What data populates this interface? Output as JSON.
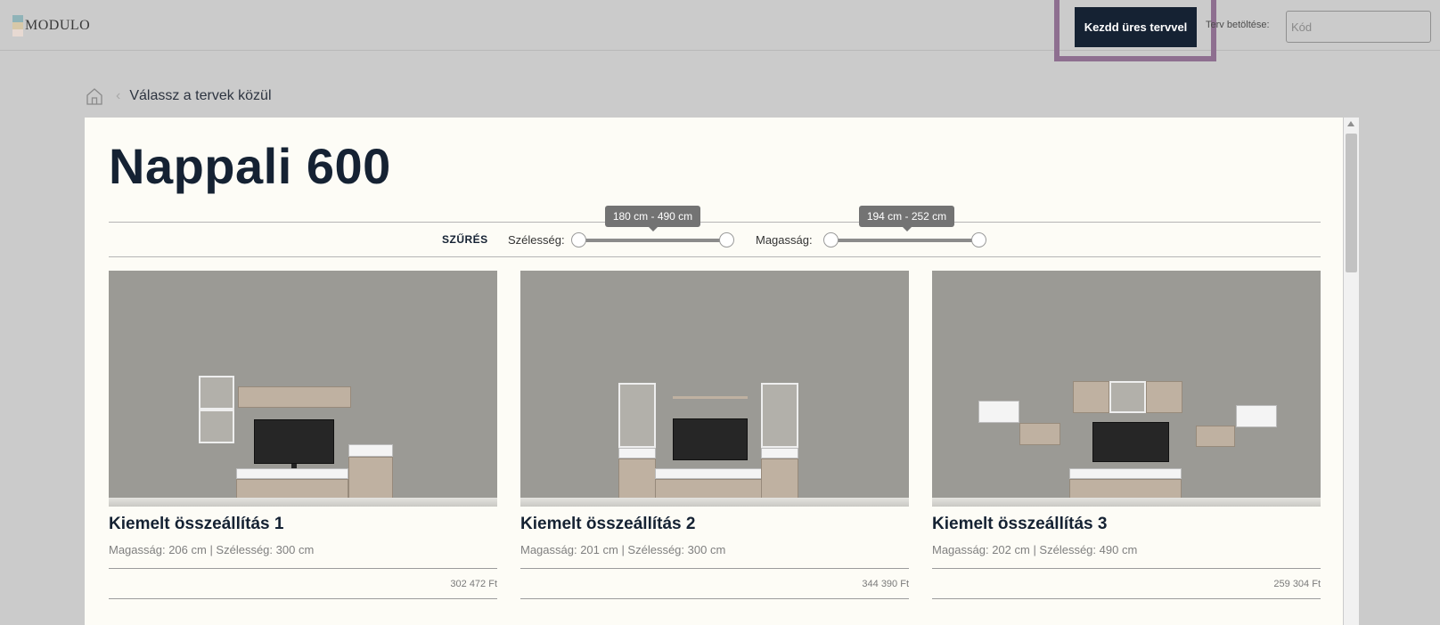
{
  "header": {
    "logo_text": "MODULO",
    "start_button": "Kezdd üres tervvel",
    "load_label": "Terv betöltése:",
    "code_placeholder": "Kód"
  },
  "breadcrumb": {
    "home_icon": "home-icon",
    "separator_icon": "chevron-left-icon",
    "current": "Válassz a tervek közül"
  },
  "page": {
    "title": "Nappali 600"
  },
  "filter": {
    "label": "SZŰRÉS",
    "width": {
      "label": "Szélesség:",
      "range_text": "180 cm - 490 cm",
      "min": 180,
      "max": 490
    },
    "height": {
      "label": "Magasság:",
      "range_text": "194 cm - 252 cm",
      "min": 194,
      "max": 252
    }
  },
  "cards": [
    {
      "title": "Kiemelt összeállítás 1",
      "dims": "Magasság: 206 cm | Szélesség: 300 cm",
      "price": "302 472 Ft"
    },
    {
      "title": "Kiemelt összeállítás 2",
      "dims": "Magasság: 201 cm | Szélesség: 300 cm",
      "price": "344 390 Ft"
    },
    {
      "title": "Kiemelt összeállítás 3",
      "dims": "Magasság: 202 cm | Szélesség: 490 cm",
      "price": "259 304 Ft"
    }
  ],
  "colors": {
    "primary": "#152233",
    "highlight": "#8e6f90",
    "panel_bg": "#fdfcf6",
    "page_bg": "#cbcbcb"
  }
}
